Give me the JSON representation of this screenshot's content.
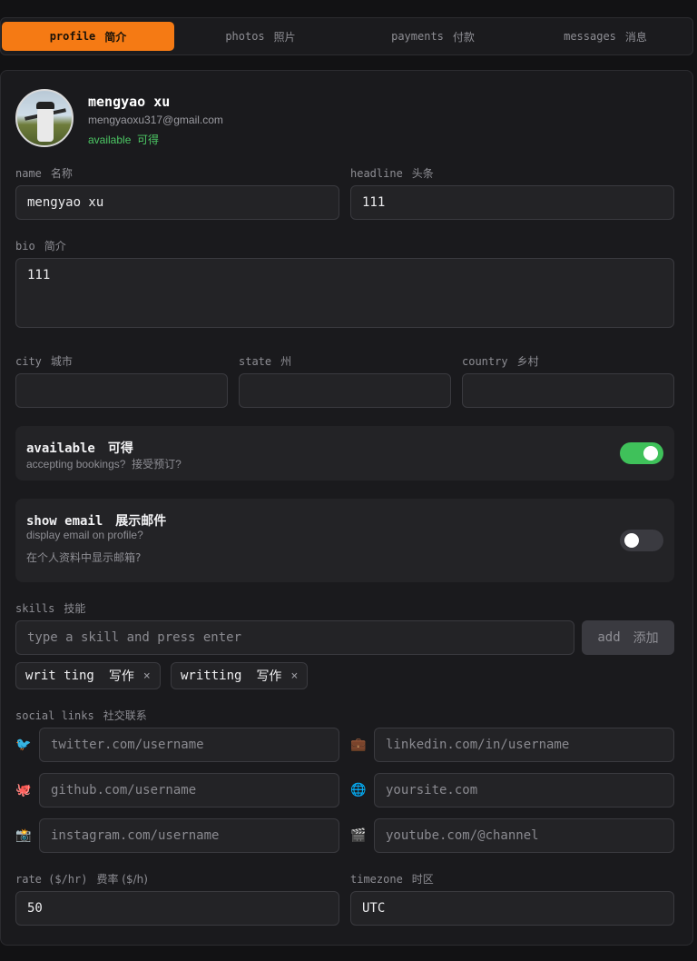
{
  "tabs": [
    {
      "label": "profile",
      "cn": "简介",
      "active": true
    },
    {
      "label": "photos",
      "cn": "照片",
      "active": false
    },
    {
      "label": "payments",
      "cn": "付款",
      "active": false
    },
    {
      "label": "messages",
      "cn": "消息",
      "active": false
    }
  ],
  "profile": {
    "name": "mengyao xu",
    "email": "mengyaoxu317@gmail.com",
    "status": "available  可得"
  },
  "fields": {
    "name": {
      "label": "name",
      "cn": "名称",
      "value": "mengyao xu"
    },
    "headline": {
      "label": "headline",
      "cn": "头条",
      "value": "111"
    },
    "bio": {
      "label": "bio",
      "cn": "简介",
      "value": "111"
    },
    "city": {
      "label": "city",
      "cn": "城市",
      "value": ""
    },
    "state": {
      "label": "state",
      "cn": "州",
      "value": ""
    },
    "country": {
      "label": "country",
      "cn": "乡村",
      "value": ""
    }
  },
  "available": {
    "title": "available",
    "cn": "可得",
    "sub": "accepting bookings?  接受预订?",
    "on": true
  },
  "show_email": {
    "title": "show email",
    "cn": "展示邮件",
    "sub1": "display email on profile?",
    "sub2": "在个人资料中显示邮箱?",
    "on": false
  },
  "skills": {
    "label": "skills",
    "cn": "技能",
    "placeholder": "type a skill and press enter",
    "add_label": "add",
    "add_cn": "添加",
    "chips": [
      {
        "text": "writ ting",
        "cn": "写作",
        "remove": "×"
      },
      {
        "text": "writting",
        "cn": "写作",
        "remove": "×"
      }
    ]
  },
  "social": {
    "label": "social links",
    "cn": "社交联系",
    "links": [
      {
        "icon": "bird-icon",
        "glyph": "🐦",
        "placeholder": "twitter.com/username"
      },
      {
        "icon": "briefcase-icon",
        "glyph": "💼",
        "placeholder": "linkedin.com/in/username"
      },
      {
        "icon": "octopus-icon",
        "glyph": "🐙",
        "placeholder": "github.com/username"
      },
      {
        "icon": "globe-icon",
        "glyph": "🌐",
        "placeholder": "yoursite.com"
      },
      {
        "icon": "camera-icon",
        "glyph": "📸",
        "placeholder": "instagram.com/username"
      },
      {
        "icon": "clapper-icon",
        "glyph": "🎬",
        "placeholder": "youtube.com/@channel"
      }
    ]
  },
  "rate": {
    "label": "rate ($/hr)",
    "cn": "费率 ($/h)",
    "value": "50"
  },
  "timezone": {
    "label": "timezone",
    "cn": "时区",
    "value": "UTC"
  },
  "colors": {
    "accent": "#f57a14",
    "success": "#3fc15a"
  }
}
